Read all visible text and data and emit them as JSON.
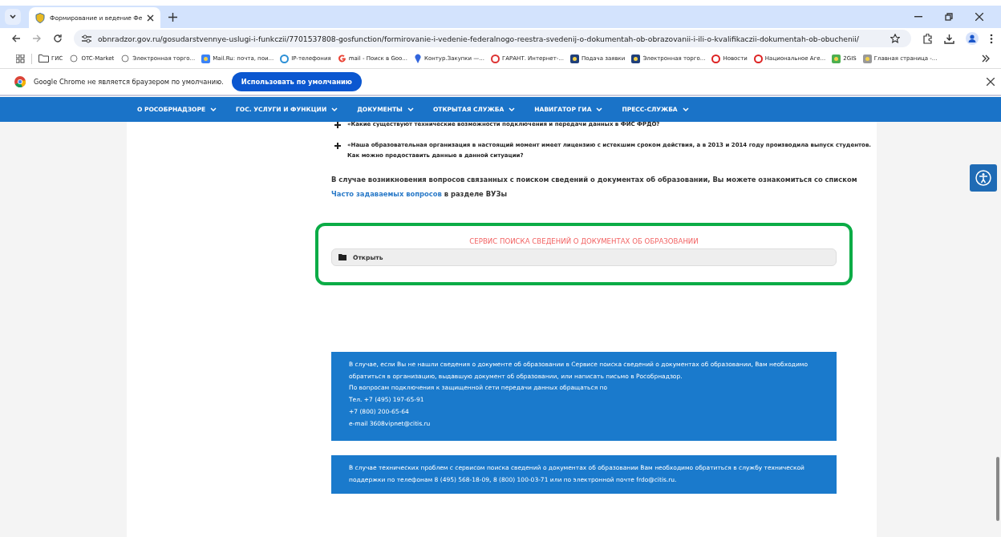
{
  "browser": {
    "tabs": [
      {
        "title": "Формирование и ведение Фе",
        "selected": true
      }
    ],
    "url": "obnradzor.gov.ru/gosudarstvennye-uslugi-i-funkczii/7701537808-gosfunction/formirovanie-i-vedenie-federalnogo-reestra-svedenij-o-dokumentah-ob-obrazovanii-i-ili-o-kvalifikaczii-dokumentah-ob-obuchenii/",
    "bookmarks": [
      {
        "label": "ГИС",
        "kind": "folder"
      },
      {
        "label": "OTC-Market",
        "kind": "otc"
      },
      {
        "label": "Электронная торго...",
        "kind": "otc"
      },
      {
        "label": "Mail.Ru: почта, пои...",
        "kind": "mail"
      },
      {
        "label": "IP-телефония",
        "kind": "globe"
      },
      {
        "label": "mail - Поиск в Goo...",
        "kind": "google"
      },
      {
        "label": "Контур.Закупки —...",
        "kind": "pin"
      },
      {
        "label": "ГАРАНТ. Интернет-...",
        "kind": "flag"
      },
      {
        "label": "Подача заявки",
        "kind": "emblem"
      },
      {
        "label": "Электронная торго...",
        "kind": "emblem"
      },
      {
        "label": "Новости",
        "kind": "swirl"
      },
      {
        "label": "Национальное Аге...",
        "kind": "swirl"
      },
      {
        "label": "2GIS",
        "kind": "map"
      },
      {
        "label": "Главная страница -...",
        "kind": "page"
      }
    ],
    "infobar": {
      "message": "Google Chrome не является браузером по умолчанию.",
      "button": "Использовать по умолчанию"
    }
  },
  "nav": [
    {
      "label": "О РОСОБРНАДЗОРЕ"
    },
    {
      "label": "ГОС. УСЛУГИ И ФУНКЦИИ"
    },
    {
      "label": "ДОКУМЕНТЫ"
    },
    {
      "label": "ОТКРЫТАЯ СЛУЖБА"
    },
    {
      "label": "НАВИГАТОР ГИА"
    },
    {
      "label": "ПРЕСС-СЛУЖБА"
    }
  ],
  "faq": [
    {
      "lines": [
        "«Какие существуют технические возможности подключения и передачи данных в ФИС ФРДО?"
      ]
    },
    {
      "lines": [
        "«Наша образовательная организация в настоящий момент имеет лицензию с истекшим сроком действия, а в 2013 и 2014 году производила выпуск студентов.",
        "Как можно предоставить данные в данной ситуации?"
      ]
    }
  ],
  "notice": {
    "text": "В случае возникновения вопросов связанных с поиском сведений о документах об образовании, Вы можете ознакомиться со списком",
    "link": "Часто задаваемых вопросов",
    "after": "в разделе ВУЗы"
  },
  "service": {
    "title": "СЕРВИС ПОИСКА СВЕДЕНИЙ О ДОКУМЕНТАХ ОБ ОБРАЗОВАНИИ",
    "button": "Открыть"
  },
  "info_boxes": [
    {
      "lines": [
        "В случае, если Вы не нашли сведения о документе об образовании в Сервисе поиска сведений о документах об образовании, Вам необходимо обратиться в организацию, выдавшую документ об образовании, или написать письмо в Рособрнадзор.",
        "По вопросам подключения к защищенной сети передачи данных обращаться по",
        "Тел. +7 (495) 197-65-91",
        "+7 (800) 200-65-64",
        "e-mail 3608vipnet@citis.ru"
      ]
    },
    {
      "lines": [
        "В случае технических проблем с сервисом поиска сведений о документах об образовании Вам необходимо обратиться в службу технической поддержки по телефонам  8 (495) 568-18-09, 8 (800) 100-03-71 или по электронной почте frdo@citis.ru."
      ]
    }
  ]
}
